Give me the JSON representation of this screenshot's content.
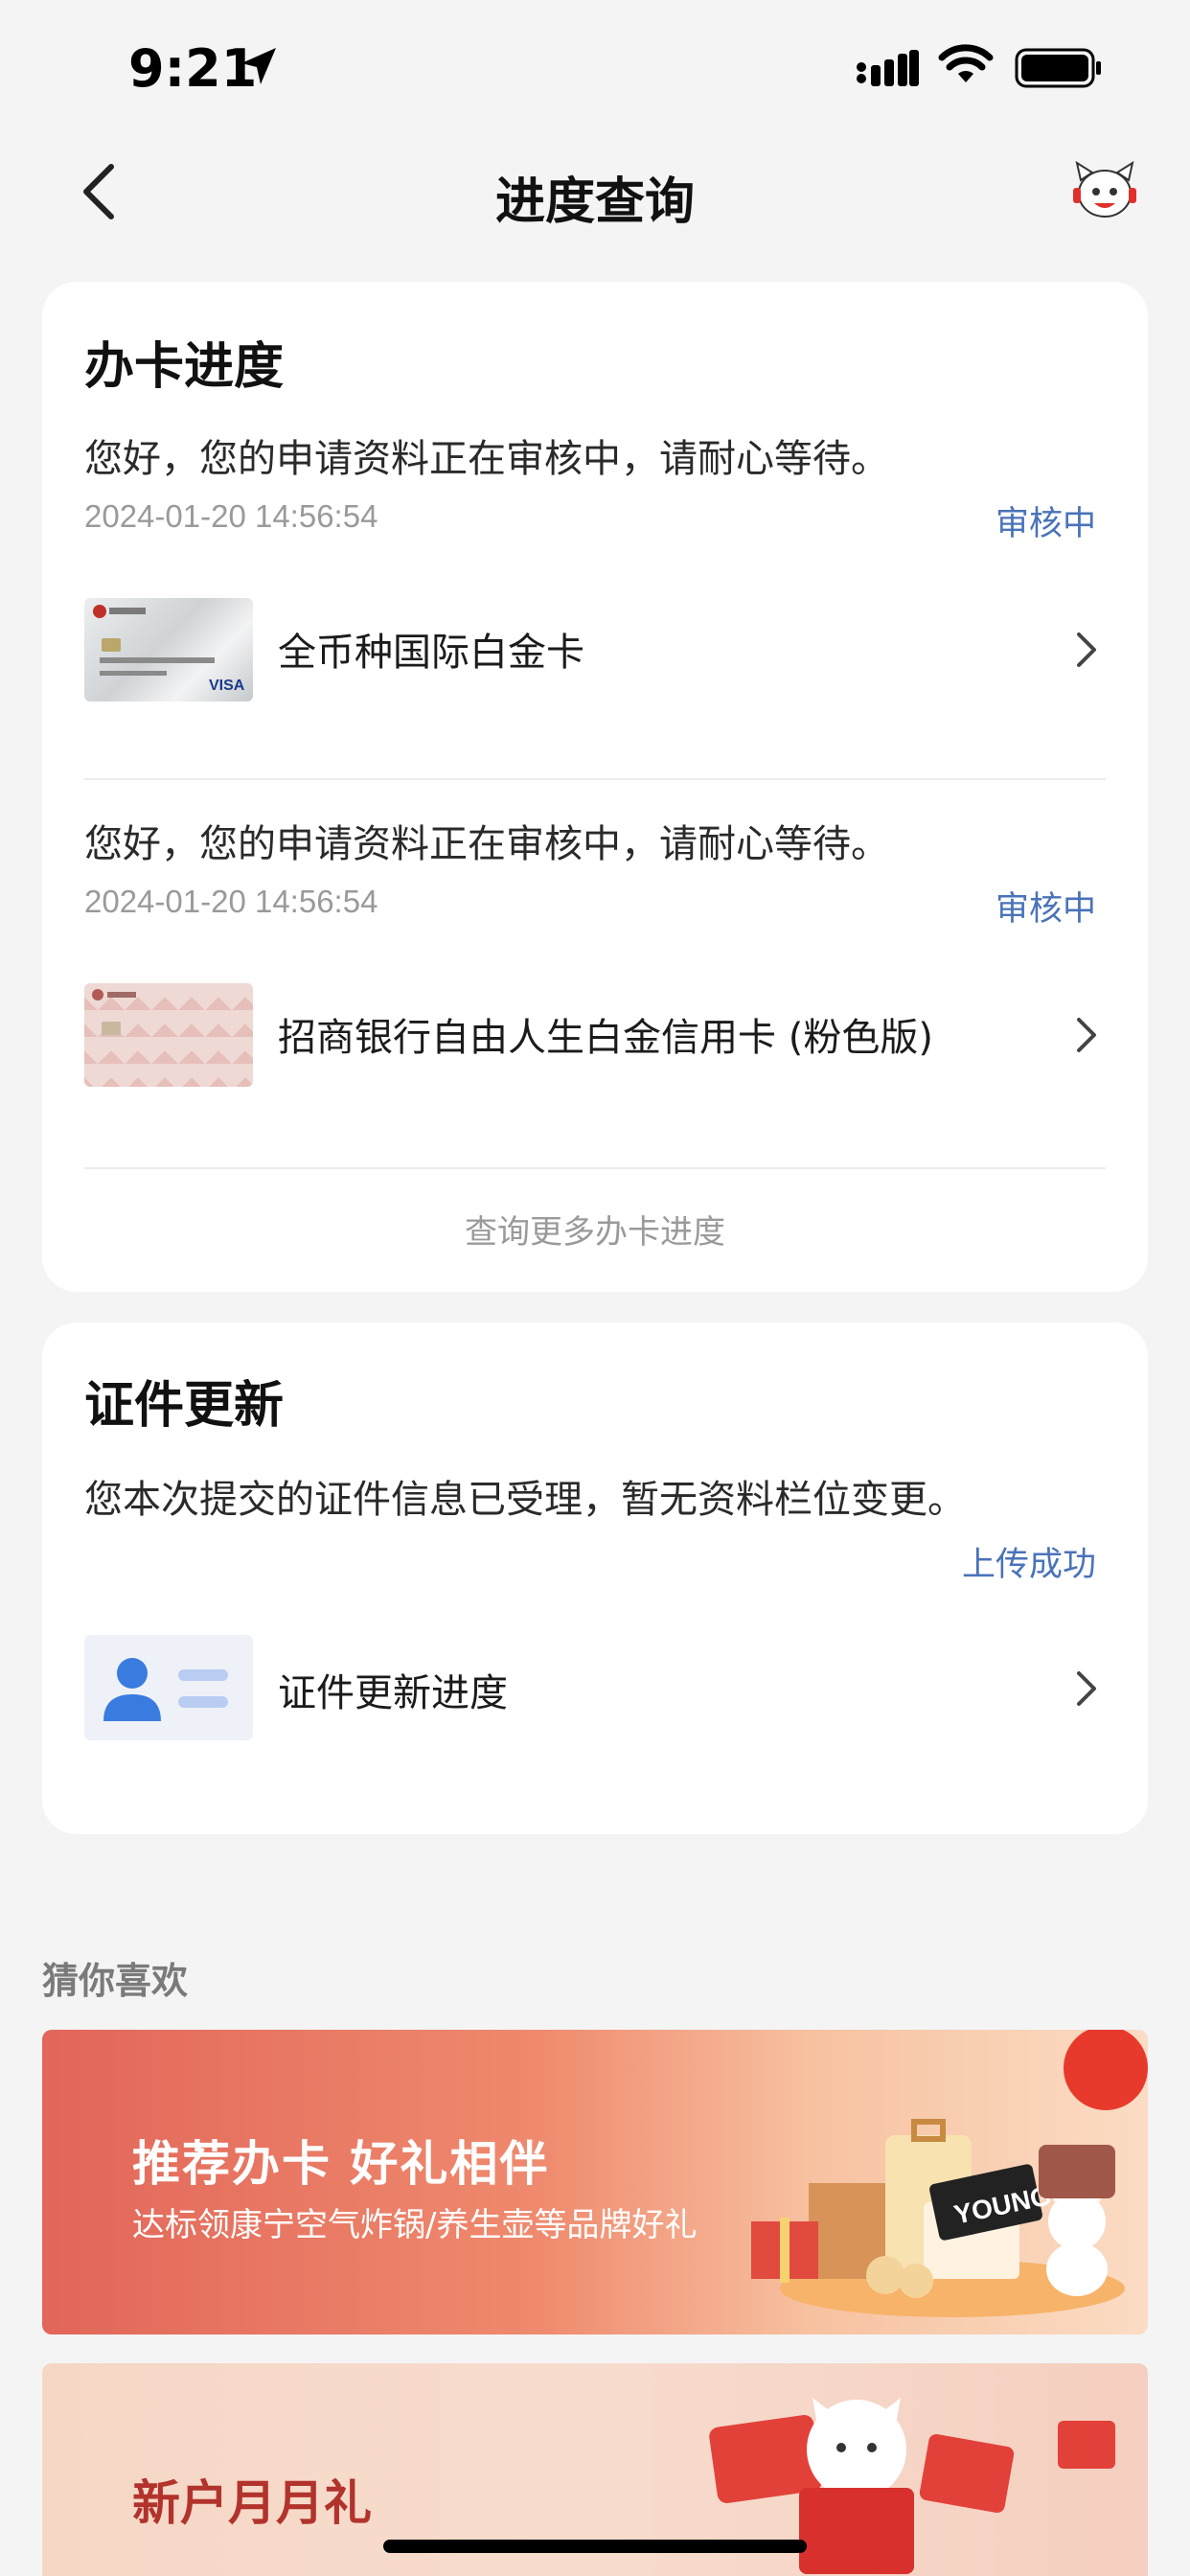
{
  "status_bar": {
    "time": "9:21"
  },
  "nav": {
    "title": "进度查询"
  },
  "card_progress": {
    "title": "办卡进度",
    "items": [
      {
        "message": "您好，您的申请资料正在审核中，请耐心等待。",
        "timestamp": "2024-01-20 14:56:54",
        "status": "审核中",
        "card_name": "全币种国际白金卡"
      },
      {
        "message": "您好，您的申请资料正在审核中，请耐心等待。",
        "timestamp": "2024-01-20 14:56:54",
        "status": "审核中",
        "card_name": "招商银行自由人生白金信用卡 (粉色版)"
      }
    ],
    "more_link": "查询更多办卡进度"
  },
  "card_id_update": {
    "title": "证件更新",
    "message": "您本次提交的证件信息已受理，暂无资料栏位变更。",
    "status": "上传成功",
    "item_label": "证件更新进度"
  },
  "recommend": {
    "section_title": "猜你喜欢",
    "banner1": {
      "title": "推荐办卡 好礼相伴",
      "subtitle": "达标领康宁空气炸锅/养生壶等品牌好礼"
    },
    "banner2": {
      "title": "新户月月礼"
    }
  },
  "colors": {
    "status_blue": "#4a73b8",
    "background": "#f4f4f5",
    "banner_red": "#e26659"
  }
}
